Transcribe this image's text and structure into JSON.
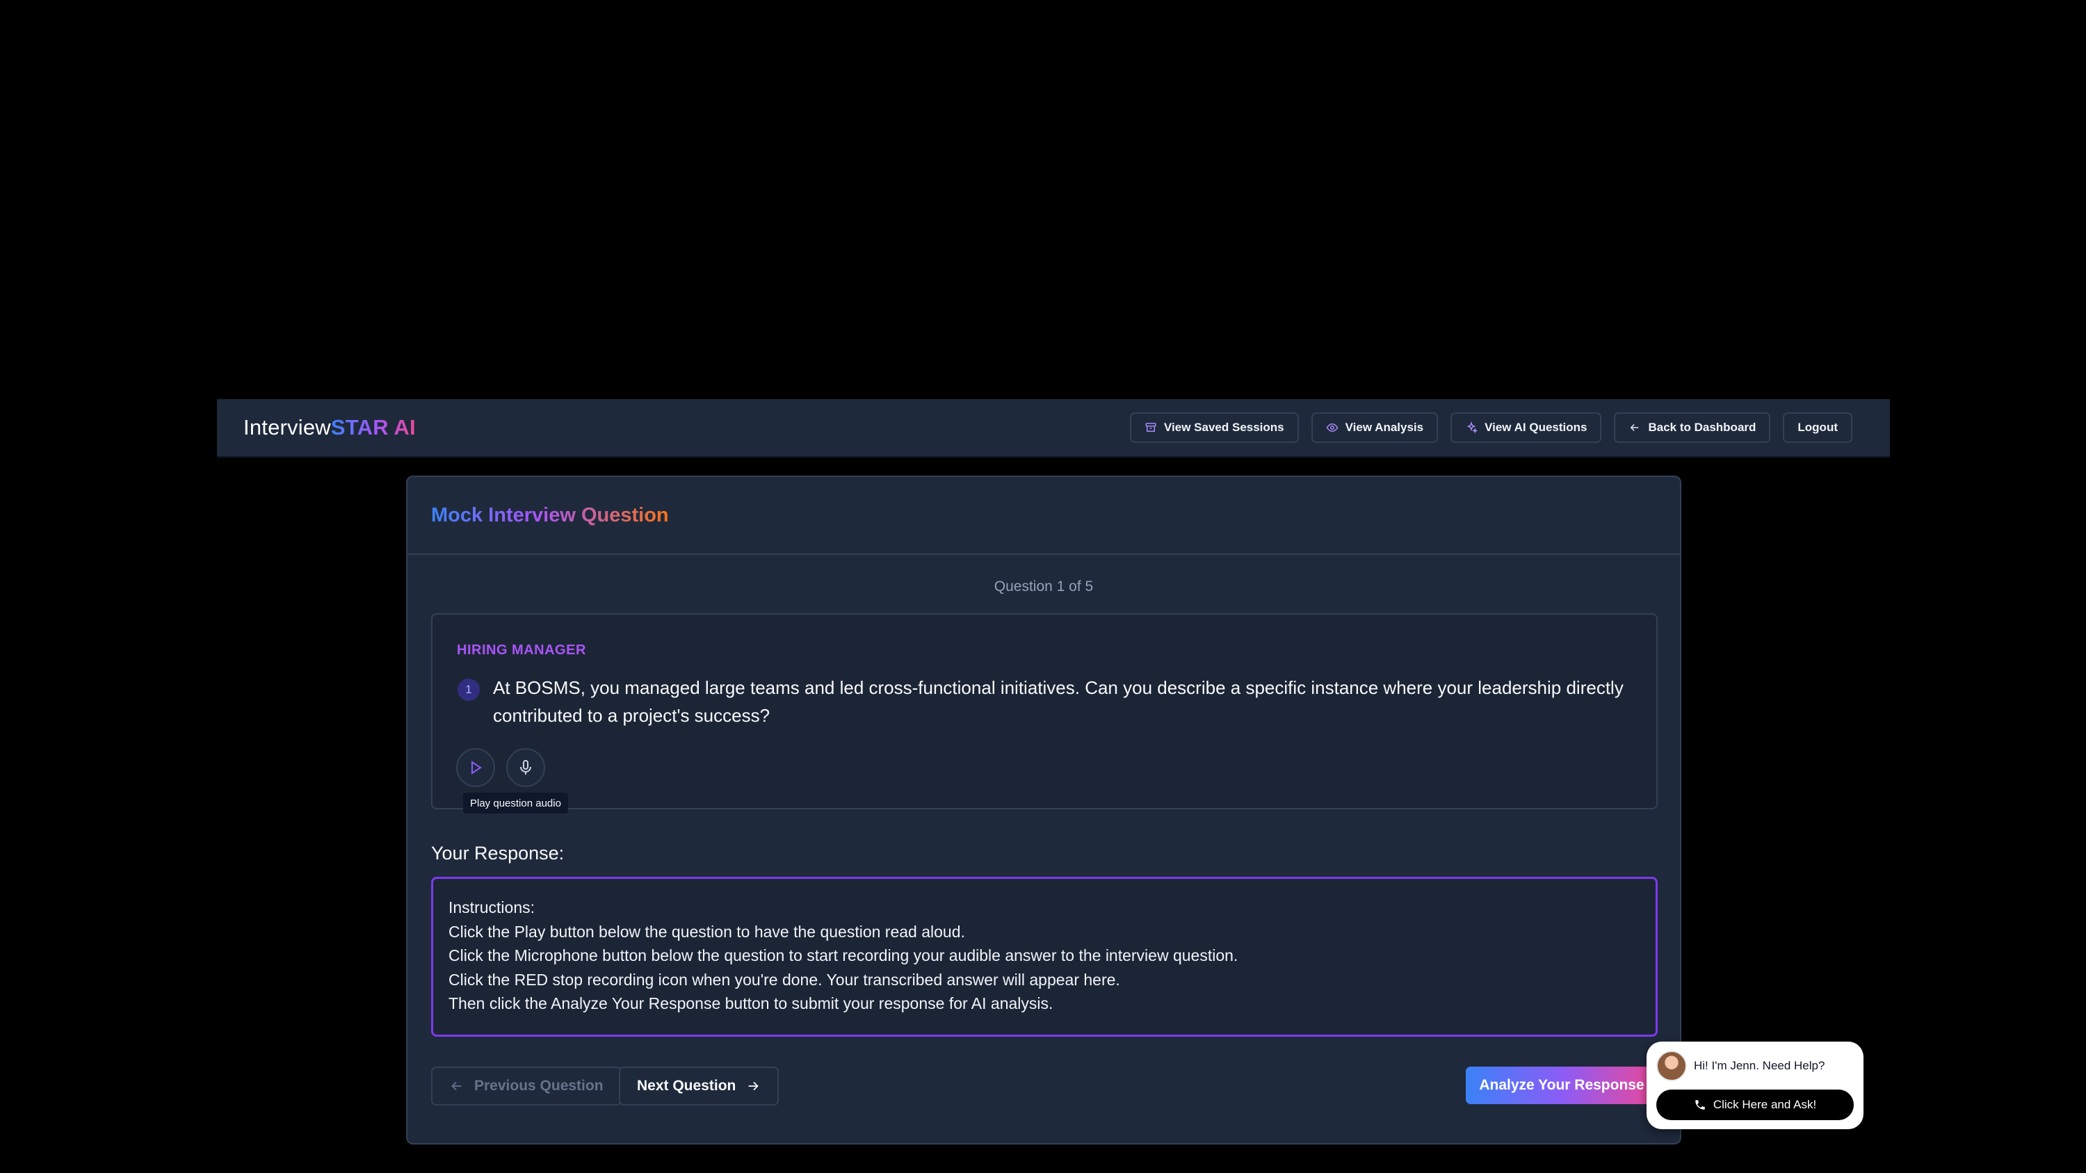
{
  "brand": {
    "prefix": "Interview",
    "accent": "STAR AI"
  },
  "nav": {
    "saved_sessions": "View Saved Sessions",
    "analysis": "View Analysis",
    "ai_questions": "View AI Questions",
    "back": "Back to Dashboard",
    "logout": "Logout"
  },
  "card": {
    "title": "Mock Interview Question"
  },
  "question": {
    "counter": "Question 1 of 5",
    "role": "HIRING MANAGER",
    "number": "1",
    "text": "At BOSMS, you managed large teams and led cross-functional initiatives. Can you describe a specific instance where your leadership directly contributed to a project's success?",
    "tooltip": "Play question audio"
  },
  "response": {
    "label": "Your Response:",
    "text": "Instructions:\nClick the Play button below the question to have the question read aloud.\nClick the Microphone button below the question to start recording your audible answer to the interview question.\nClick the RED stop recording icon when you're done. Your transcribed answer will appear here.\nThen click the Analyze Your Response button to submit your response for AI analysis."
  },
  "controls": {
    "previous": "Previous Question",
    "next": "Next Question",
    "analyze": "Analyze Your Response"
  },
  "help": {
    "greeting": "Hi! I'm Jenn. Need Help?",
    "cta": "Click Here and Ask!"
  },
  "colors": {
    "page_bg": "#000000",
    "panel_bg": "#1e293b",
    "accent_purple": "#7c3aed",
    "gradient_start": "#3b82f6",
    "gradient_end": "#ec4899"
  },
  "icons": [
    "archive-icon",
    "eye-icon",
    "sparkles-icon",
    "arrow-left-icon",
    "play-icon",
    "microphone-icon",
    "arrow-right-icon",
    "phone-icon"
  ]
}
